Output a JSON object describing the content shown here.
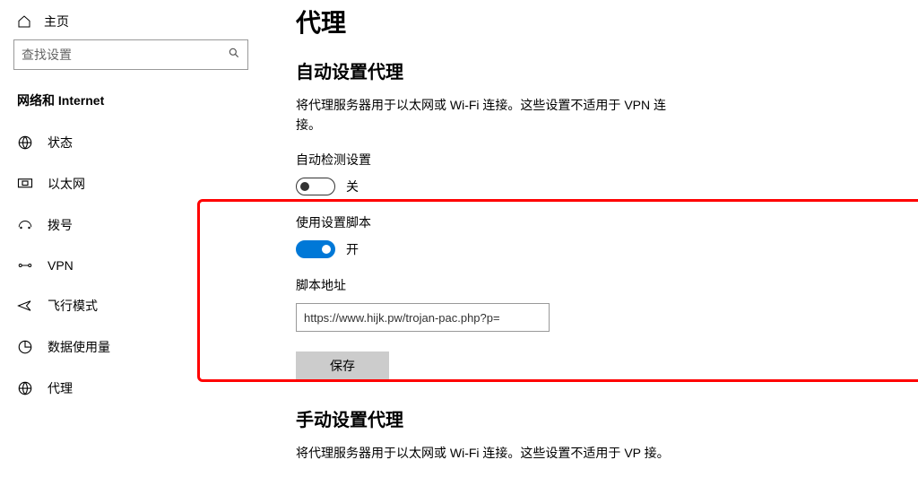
{
  "sidebar": {
    "home": "主页",
    "search_placeholder": "查找设置",
    "section_title": "网络和 Internet",
    "items": [
      {
        "label": "状态"
      },
      {
        "label": "以太网"
      },
      {
        "label": "拨号"
      },
      {
        "label": "VPN"
      },
      {
        "label": "飞行模式"
      },
      {
        "label": "数据使用量"
      },
      {
        "label": "代理"
      }
    ]
  },
  "main": {
    "page_title": "代理",
    "auto_section": {
      "heading": "自动设置代理",
      "description": "将代理服务器用于以太网或 Wi-Fi 连接。这些设置不适用于 VPN 连接。",
      "auto_detect_label": "自动检测设置",
      "auto_detect_state": "关",
      "use_script_label": "使用设置脚本",
      "use_script_state": "开",
      "script_address_label": "脚本地址",
      "script_address_value": "https://www.hijk.pw/trojan-pac.php?p=",
      "save_label": "保存"
    },
    "manual_section": {
      "heading": "手动设置代理",
      "description": "将代理服务器用于以太网或 Wi-Fi 连接。这些设置不适用于 VP 接。"
    }
  }
}
